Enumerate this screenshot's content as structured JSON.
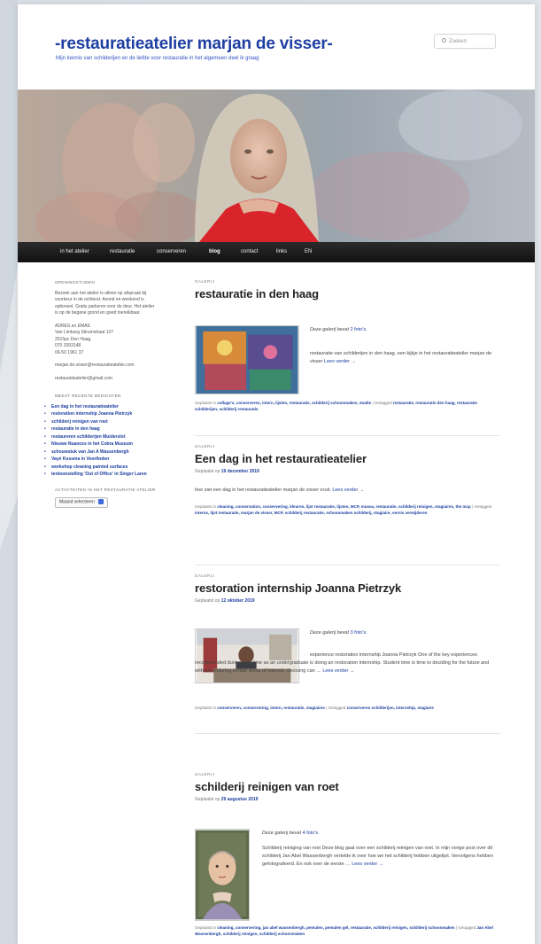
{
  "site": {
    "title": "-restauratieatelier marjan de visser-",
    "description": "Mijn kennis van schilderijen en de liefde voor restauratie in het algemeen deel ik graag",
    "search_placeholder": "Zoeken"
  },
  "nav": {
    "items": [
      {
        "label": "in het atelier"
      },
      {
        "label": "restauratie"
      },
      {
        "label": "conserveren"
      },
      {
        "label": "blog"
      },
      {
        "label": "contact"
      },
      {
        "label": "links"
      },
      {
        "label": "EN"
      }
    ],
    "active": "blog"
  },
  "sidebar": {
    "hours_title": "OPENINGSTIJDEN",
    "hours_text": "Bezoek aan het atelier is alleen op afspraak bij voorkeur in de ochtend. Avond en weekend is optioneel. Gratis parkeren voor de deur. Het atelier is op de begane grond en goed toereikbaar.",
    "address_lines": [
      "ADRES en EMAIL",
      "Van Limburg Stirumstraat 127",
      "2515pc Den Haag",
      "070 3393148",
      "06-50 1961 37"
    ],
    "email1": "marjan.de.visser@restauratieatelier.com",
    "email2": "restauratieatelier@gmail.com",
    "recent_title": "MEEST RECENTE BERICHTEN",
    "recent_posts": [
      "Een dag in het restauratieatelier",
      "restoration internship Joanna Pietrzyk",
      "schilderij reinigen van roet",
      "restauratie in den haag",
      "restaureren schilderijen Muiderslot",
      "Nieuwe Nuances in het Cobra Museum",
      "schouwstuk van Jan A Wassenbergh",
      "Vayé Kussma in Voorlinden",
      "workshop cleaning painted surfaces",
      "tentoonstelling 'Out of Office' in Singer Laren"
    ],
    "activity_title": "ACTIVITEITEN IN HET RESTAURATIE ATELIER",
    "month_select": "Maand selecteren"
  },
  "posts": [
    {
      "format": "GALERIJ",
      "title": "restauratie in den haag",
      "intro_prefix": "Deze galerij bevat",
      "intro_link": "2 foto's.",
      "excerpt": "restauratie van schilderijen in den haag. een kijkje in het restauratieatelier marjan de visser",
      "more": "Lees verder →",
      "meta_prefix": "Geplaatst in",
      "meta_cats": "collage's, conserveren, intern, lijsten, restauratie, schilderij schoonmaken, studie",
      "meta_tag_prefix": "| Getagged",
      "meta_tags": "restauratie, restauratie den haag, restauratie schilderijen, schilderij restauratie"
    },
    {
      "format": "GALERIJ",
      "title": "Een dag in het restauratieatelier",
      "date_prefix": "Geplaatst op",
      "date": "19 december 2019",
      "excerpt": "hoe ziet een dag in het restauratieatelier marjan de visser eruit.",
      "more": "Lees verder →",
      "meta_prefix": "Geplaatst in",
      "meta_cats": "cleaning, conservation, conservering, kleuren, lijst restauratie, lijsten, MCP, musea, restauratie, schilderij reinigen, stagiaires, the mcp",
      "meta_tag_prefix": "| Getagged",
      "meta_tags": "interns, lijst restauratie, marjan de visser, MCP, schilderij restauratie, schoonmaken schilderij, stagiaire, vernis verwijderen"
    },
    {
      "format": "GALERIJ",
      "title": "restoration internship Joanna Pietrzyk",
      "date_prefix": "Geplaatst op",
      "date": "12 oktober 2019",
      "intro_prefix": "Deze galerij bevat",
      "intro_link": "3 foto's.",
      "excerpt": "experience restoration internship Joanna Pietrzyk One of the key experiences recommended during your time as an undergraduate is doing an restoration internship. Student time is time to deciding for the future and without exploring certain areas of interest, choosing can …",
      "more": "Lees verder →",
      "meta_prefix": "Geplaatst in",
      "meta_cats": "conserveren, conservering, intern, restauratie, stagiaires",
      "meta_tag_prefix": "| Getagged",
      "meta_tags": "conserveren schilderijen, internship, stagiaire"
    },
    {
      "format": "GALERIJ",
      "title": "schilderij reinigen van roet",
      "date_prefix": "Geplaatst op",
      "date": "29 augustus 2019",
      "intro_prefix": "Deze galerij bevat",
      "intro_link": "4 foto's.",
      "excerpt": "Schilderij reiniging van roet Deze blog gaat over een schilderij reinigen van roet. In mijn vorige post over dit schilderij Jan Abel Wassenbergh vertelde ik over hoe we het schilderij hebben uitgelijst. Vervolgens hebben gefotografeerd. En ook over de eerste …",
      "more": "Lees verder →",
      "meta_prefix": "Geplaatst in",
      "meta_cats": "cleaning, conservering, jan abel wassenbergh, pemulen, pemulen gel, restauratie, schilderij reinigen, schilderij schoonmaken",
      "meta_tag_prefix": "| Getagged",
      "meta_tags": "Jan Abel Wassenbergh, schilderij reinigen, schilderij schoonmaken"
    }
  ],
  "colors": {
    "accent": "#1f3fa3",
    "nav_bg": "#1a1a1a",
    "link": "#1b3d9e"
  }
}
